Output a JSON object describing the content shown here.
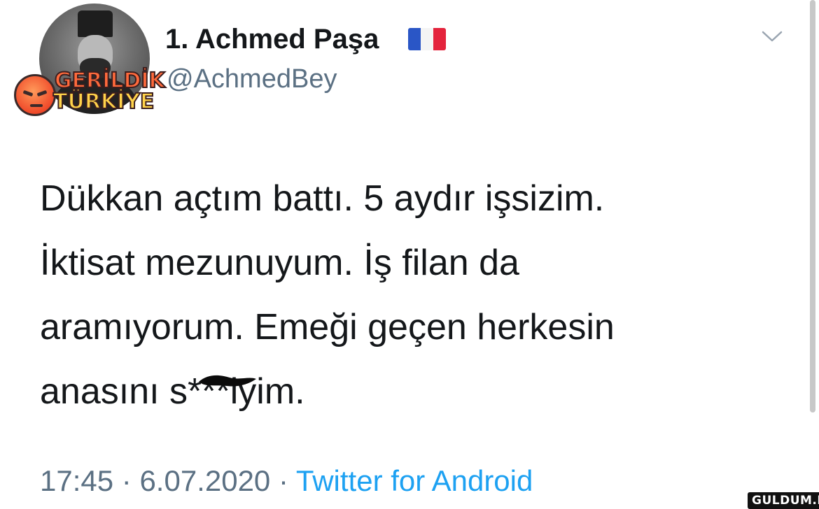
{
  "tweet": {
    "author": {
      "display_name": "1. Achmed Paşa",
      "flag_icon": "france-flag-icon",
      "handle": "@AchmedBey"
    },
    "text_lines": [
      "Dükkan açtım battı. 5 aydır işsizim.",
      "İktisat mezunuyum. İş filan da",
      "aramıyorum. Emeği geçen herkesin",
      "anasını s***iyim."
    ],
    "meta": {
      "time": "17:45",
      "separator": " · ",
      "date": "6.07.2020",
      "source": "Twitter for Android"
    },
    "menu_icon": "chevron-down-icon"
  },
  "watermarks": {
    "overlay_line1": "GERİLDİK",
    "overlay_line2": "TÜRKİYE",
    "corner": "GULDUM.NET"
  },
  "colors": {
    "text": "#14171a",
    "secondary": "#5b7083",
    "link": "#1da1f2"
  }
}
